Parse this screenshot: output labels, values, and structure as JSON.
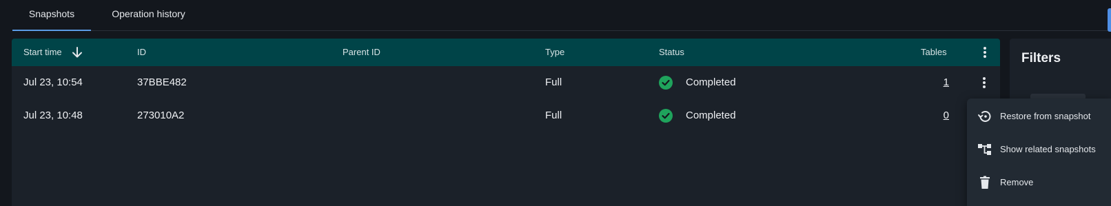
{
  "tabs": [
    {
      "label": "Snapshots",
      "active": true
    },
    {
      "label": "Operation history",
      "active": false
    }
  ],
  "table": {
    "columns": {
      "start_time": "Start time",
      "id": "ID",
      "parent_id": "Parent ID",
      "type": "Type",
      "status": "Status",
      "tables": "Tables"
    },
    "sort": {
      "column": "start_time",
      "direction": "descending",
      "icon": "arrow-down-icon"
    },
    "rows": [
      {
        "start_time": "Jul 23, 10:54",
        "id": "37BBE482",
        "parent_id": "",
        "type": "Full",
        "status": "Completed",
        "tables": "1"
      },
      {
        "start_time": "Jul 23, 10:48",
        "id": "273010A2",
        "parent_id": "",
        "type": "Full",
        "status": "Completed",
        "tables": "0"
      }
    ]
  },
  "filters": {
    "title": "Filters"
  },
  "context_menu": {
    "items": [
      {
        "label": "Restore from snapshot",
        "icon": "restore-icon"
      },
      {
        "label": "Show related snapshots",
        "icon": "tree-icon"
      },
      {
        "label": "Remove",
        "icon": "trash-icon"
      }
    ]
  },
  "colors": {
    "background": "#13171d",
    "panel": "#1b2129",
    "header": "#004448",
    "tab_accent": "#5b9ce6",
    "status_success": "#1fa35c"
  }
}
